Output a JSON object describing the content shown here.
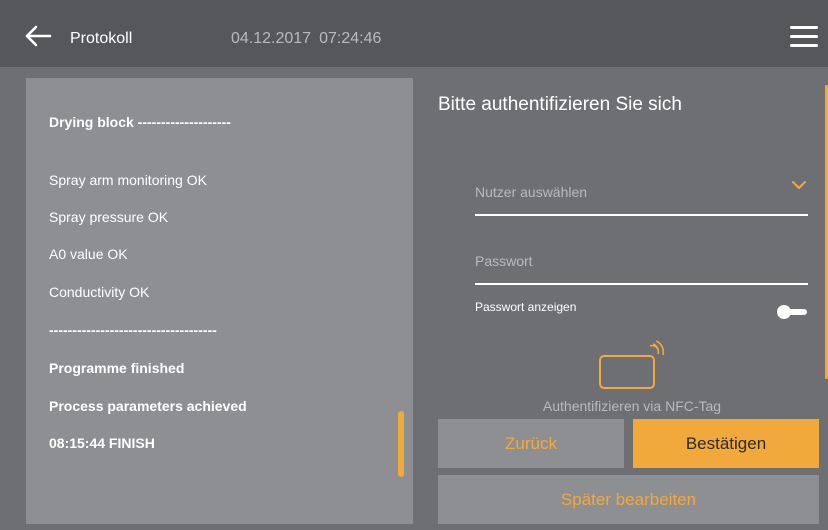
{
  "header": {
    "title": "Protokoll",
    "date": "04.12.2017",
    "time": "07:24:46",
    "back_icon": "arrow-left-icon",
    "menu_icon": "hamburger-menu-icon"
  },
  "log": {
    "lines": [
      {
        "text": "Drying block --------------------",
        "bold": true
      },
      {
        "text": "Spray arm monitoring OK",
        "bold": false
      },
      {
        "text": "Spray pressure OK",
        "bold": false
      },
      {
        "text": "A0 value OK",
        "bold": false
      },
      {
        "text": "Conductivity OK",
        "bold": false
      },
      {
        "text": "------------------------------------",
        "bold": true
      },
      {
        "text": "Programme finished",
        "bold": true
      },
      {
        "text": "Process parameters achieved",
        "bold": true
      },
      {
        "text": "08:15:44 FINISH",
        "bold": true
      }
    ]
  },
  "auth": {
    "title": "Bitte authentifizieren Sie sich",
    "user_placeholder": "Nutzer auswählen",
    "password_placeholder": "Passwort",
    "show_password_label": "Passwort anzeigen",
    "show_password_on": false,
    "nfc_label": "Authentifizieren via NFC-Tag",
    "nfc_icon": "nfc-tag-icon"
  },
  "buttons": {
    "back": "Zurück",
    "confirm": "Bestätigen",
    "later": "Später bearbeiten"
  },
  "colors": {
    "accent": "#f2a93b",
    "header_bg": "#56575a",
    "body_bg": "#6e6f72",
    "panel_bg": "#8e8f93"
  }
}
